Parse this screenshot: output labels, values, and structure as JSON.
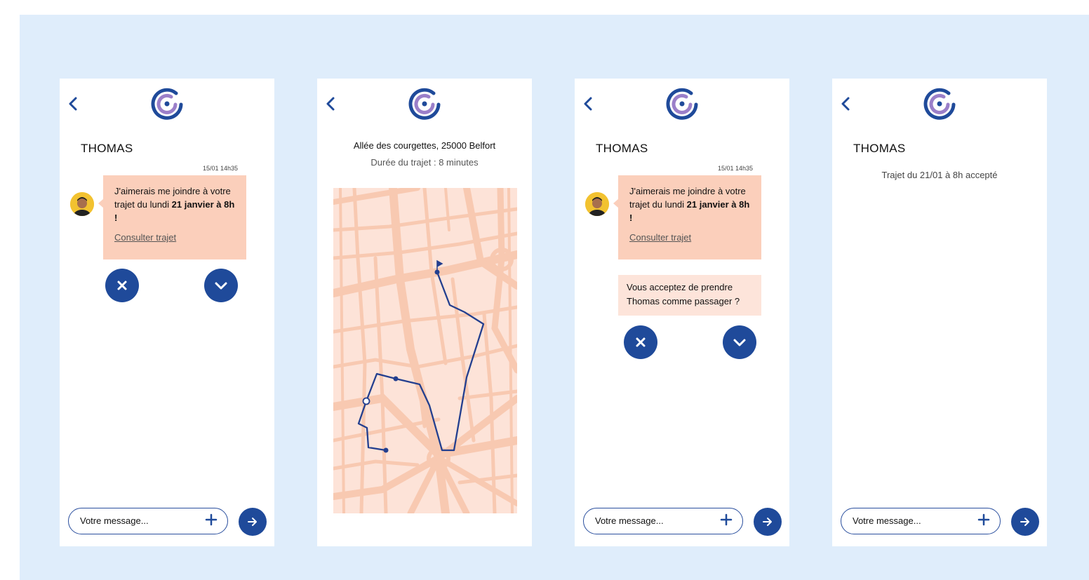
{
  "colors": {
    "primary": "#1f4a9a",
    "bubble": "#fbcfbb",
    "bubble_light": "#fde4da",
    "background": "#dfedfb",
    "map_block": "#fde3d8",
    "map_road": "#f8c9b1"
  },
  "icons": {
    "back": "chevron-left-icon",
    "logo": "app-logo-icon",
    "decline": "close-icon",
    "accept": "chevron-down-icon",
    "attach": "plus-icon",
    "send": "arrow-right-icon"
  },
  "screens": [
    {
      "contact": "THOMAS",
      "timestamp": "15/01 14h35",
      "message": {
        "prefix": "J'aimerais me joindre à votre trajet du lundi ",
        "bold": "21 janvier à 8h",
        "suffix": " !"
      },
      "link": "Consulter trajet",
      "input_placeholder": "Votre message..."
    },
    {
      "address": "Allée des courgettes, 25000 Belfort",
      "duration": "Durée du trajet : 8 minutes"
    },
    {
      "contact": "THOMAS",
      "timestamp": "15/01 14h35",
      "message": {
        "prefix": "J'aimerais me joindre à votre trajet du lundi ",
        "bold": "21 janvier à 8h",
        "suffix": " !"
      },
      "link": "Consulter trajet",
      "question": "Vous acceptez de prendre Thomas comme passager ?",
      "input_placeholder": "Votre message..."
    },
    {
      "contact": "THOMAS",
      "status": "Trajet du 21/01 à 8h accepté",
      "input_placeholder": "Votre message..."
    }
  ]
}
